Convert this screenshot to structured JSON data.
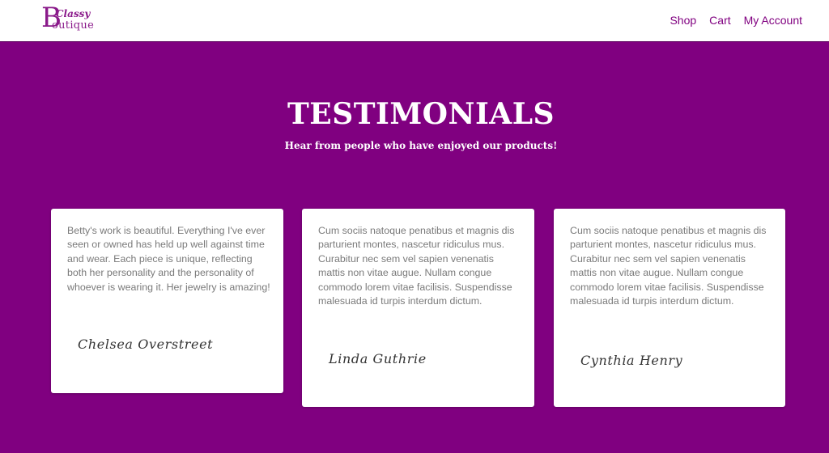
{
  "brand": {
    "logo_initial": "B",
    "logo_top": "Classy",
    "logo_rest": "outique",
    "color": "#800080"
  },
  "nav": {
    "items": [
      {
        "label": "Shop"
      },
      {
        "label": "Cart"
      },
      {
        "label": "My Account"
      }
    ]
  },
  "hero": {
    "title": "TESTIMONIALS",
    "subtitle": "Hear from people who have enjoyed our products!",
    "background": "#800080"
  },
  "testimonials": [
    {
      "text": "Betty's work is beautiful. Everything I've ever seen or owned has held up well against time and wear. Each piece is unique, reflecting both her personality and the personality of whoever is wearing it. Her jewelry is amazing!",
      "signature": "Chelsea Overstreet"
    },
    {
      "text": "Cum sociis natoque penatibus et magnis dis parturient montes, nascetur ridiculus mus. Curabitur nec sem vel sapien venenatis mattis non vitae augue. Nullam congue commodo lorem vitae facilisis. Suspendisse malesuada id turpis interdum dictum.",
      "signature": "Linda Guthrie"
    },
    {
      "text": "Cum sociis natoque penatibus et magnis dis parturient montes, nascetur ridiculus mus. Curabitur nec sem vel sapien venenatis mattis non vitae augue. Nullam congue commodo lorem vitae facilisis. Suspendisse malesuada id turpis interdum dictum.",
      "signature": "Cynthia Henry"
    }
  ]
}
